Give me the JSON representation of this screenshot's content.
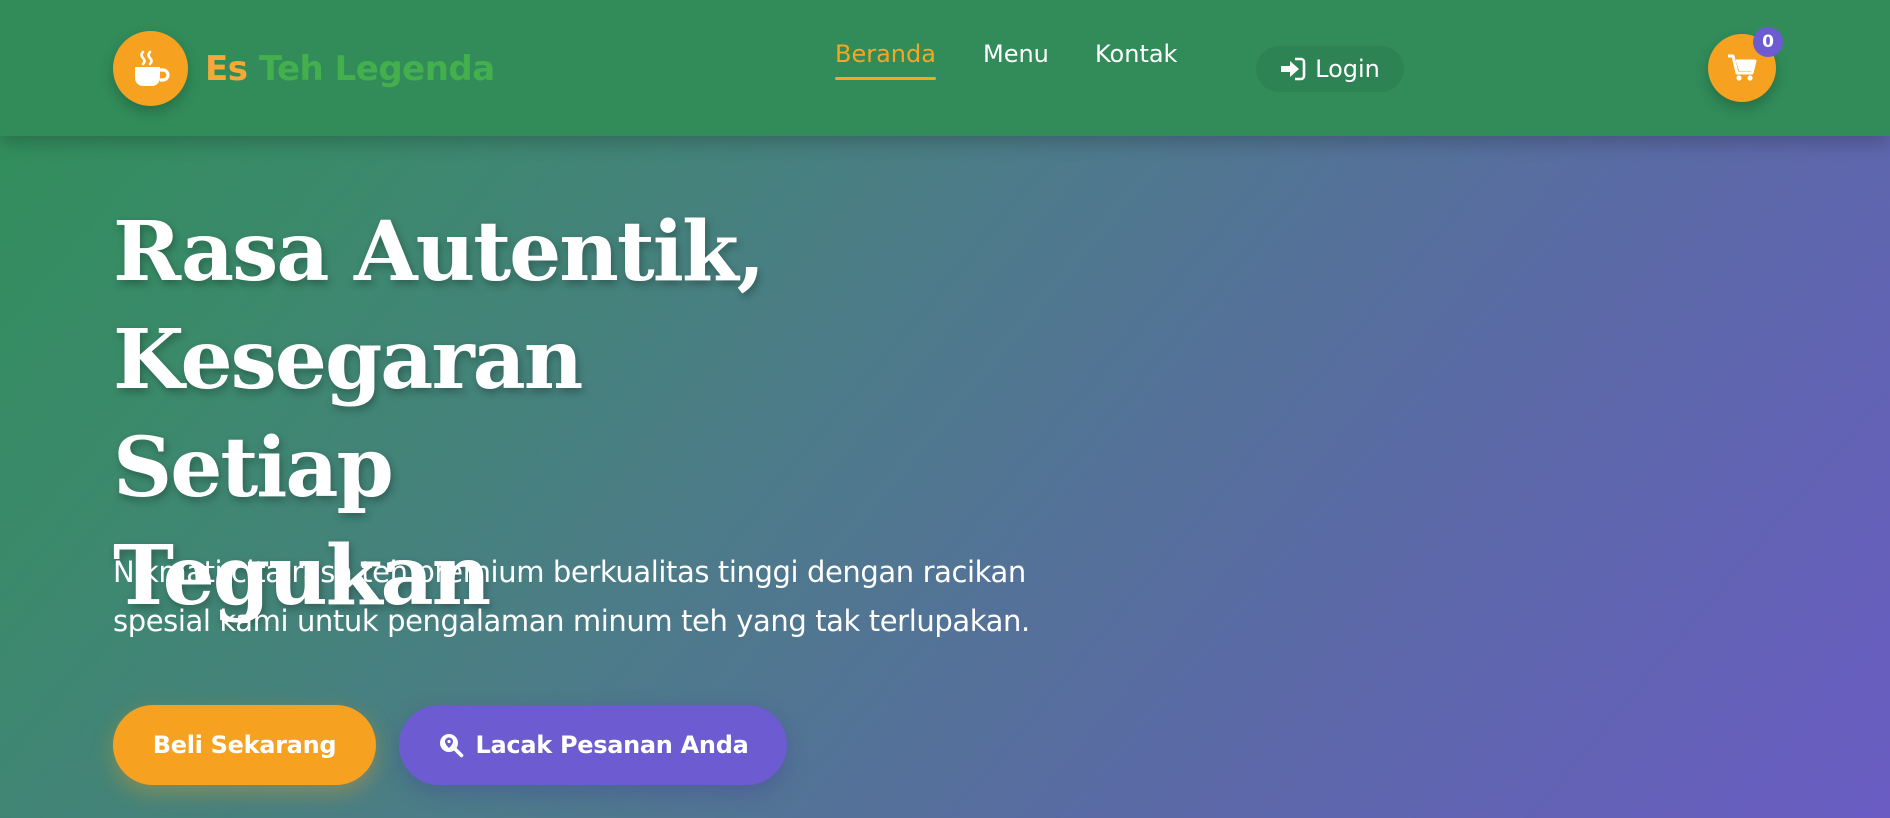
{
  "brand": {
    "name_part1": "Es",
    "name_part2": "Teh Legenda",
    "logo_icon": "mug-hot-icon"
  },
  "nav": {
    "links": [
      {
        "label": "Beranda",
        "active": true
      },
      {
        "label": "Menu",
        "active": false
      },
      {
        "label": "Kontak",
        "active": false
      }
    ],
    "login_label": "Login",
    "login_icon": "sign-in-icon",
    "cart_icon": "shopping-cart-icon",
    "cart_count": "0"
  },
  "hero": {
    "title_line1": "Rasa Autentik,",
    "title_line2": "Kesegaran Setiap",
    "title_line3": "Tegukan",
    "subtitle_line1": "Nikmati cita rasa teh premium berkualitas tinggi dengan racikan",
    "subtitle_line2": "spesial kami untuk pengalaman minum teh yang tak terlupakan.",
    "buy_label": "Beli Sekarang",
    "track_label": "Lacak Pesanan Anda",
    "track_icon": "search-location-icon"
  },
  "colors": {
    "navbar": "#318c5a",
    "accent_orange": "#f7a120",
    "accent_purple": "#6c5bd1",
    "brand_green": "#43b04d",
    "gradient_start": "#2f8f57",
    "gradient_end": "#6a5cc3"
  }
}
